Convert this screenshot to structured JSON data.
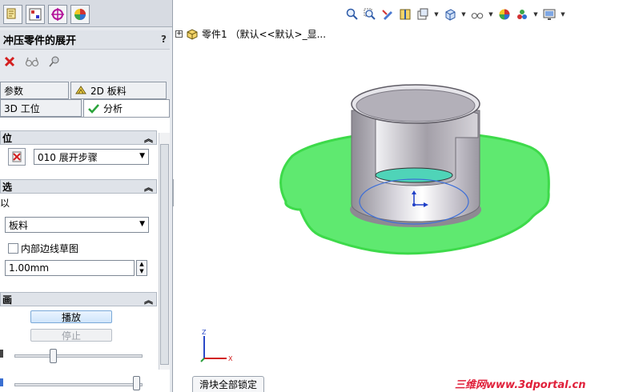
{
  "panel": {
    "title": "冲压零件的展开",
    "help": "?",
    "tabs": [
      {
        "label": "参数"
      },
      {
        "label": "2D 板料"
      },
      {
        "label": "3D 工位"
      },
      {
        "label": "分析"
      }
    ],
    "group1": {
      "title": "位",
      "step_value": "010 展开步骤"
    },
    "group2": {
      "title": "选",
      "sub_label": "以",
      "material_value": "板料",
      "inner_edge_label": "内部边线草图",
      "thickness_value": "1.00mm"
    },
    "group3": {
      "title": "画",
      "play_label": "播放",
      "stop_label": "停止"
    }
  },
  "tree": {
    "root_label": "零件1 （默认<<默认>_显..."
  },
  "tooltip": "滑块全部锁定",
  "watermark": "三维网www.3dportal.cn",
  "colors": {
    "blank": "#59ec6a",
    "cup": "#b9b6bf",
    "selection": "#3d6fd8"
  }
}
